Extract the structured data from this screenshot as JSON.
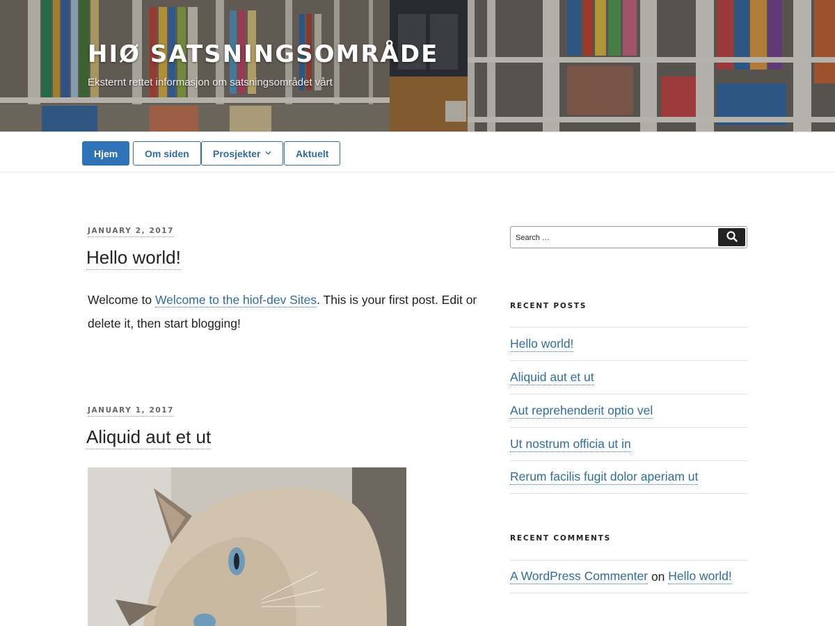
{
  "site": {
    "title": "HIØ SATSNINGSOMRÅDE",
    "description": "Eksternt rettet informasjon om satsningsområdet vårt"
  },
  "nav": {
    "items": [
      {
        "label": "Hjem"
      },
      {
        "label": "Om siden"
      },
      {
        "label": "Prosjekter",
        "icon": "chevron-down-icon"
      },
      {
        "label": "Aktuelt"
      }
    ]
  },
  "posts": [
    {
      "date": "JANUARY 2, 2017",
      "title": "Hello world!",
      "body_prefix": "Welcome to ",
      "body_link": "Welcome to the hiof-dev Sites",
      "body_suffix": ". This is your first post. Edit or delete it, then start blogging!"
    },
    {
      "date": "JANUARY 1, 2017",
      "title": "Aliquid aut et ut",
      "image": "cat-photo"
    }
  ],
  "sidebar": {
    "search": {
      "placeholder": "Search …",
      "icon": "search-icon"
    },
    "recent_posts": {
      "title": "RECENT POSTS",
      "items": [
        "Hello world!",
        "Aliquid aut et ut",
        "Aut reprehenderit optio vel",
        "Ut nostrum officia ut in",
        "Rerum facilis fugit dolor aperiam ut"
      ]
    },
    "recent_comments": {
      "title": "RECENT COMMENTS",
      "items": [
        {
          "author": "A WordPress Commenter",
          "joiner": "on",
          "post": "Hello world!"
        }
      ]
    }
  },
  "colors": {
    "accent": "#2e72b8",
    "link": "#2e6da4"
  }
}
